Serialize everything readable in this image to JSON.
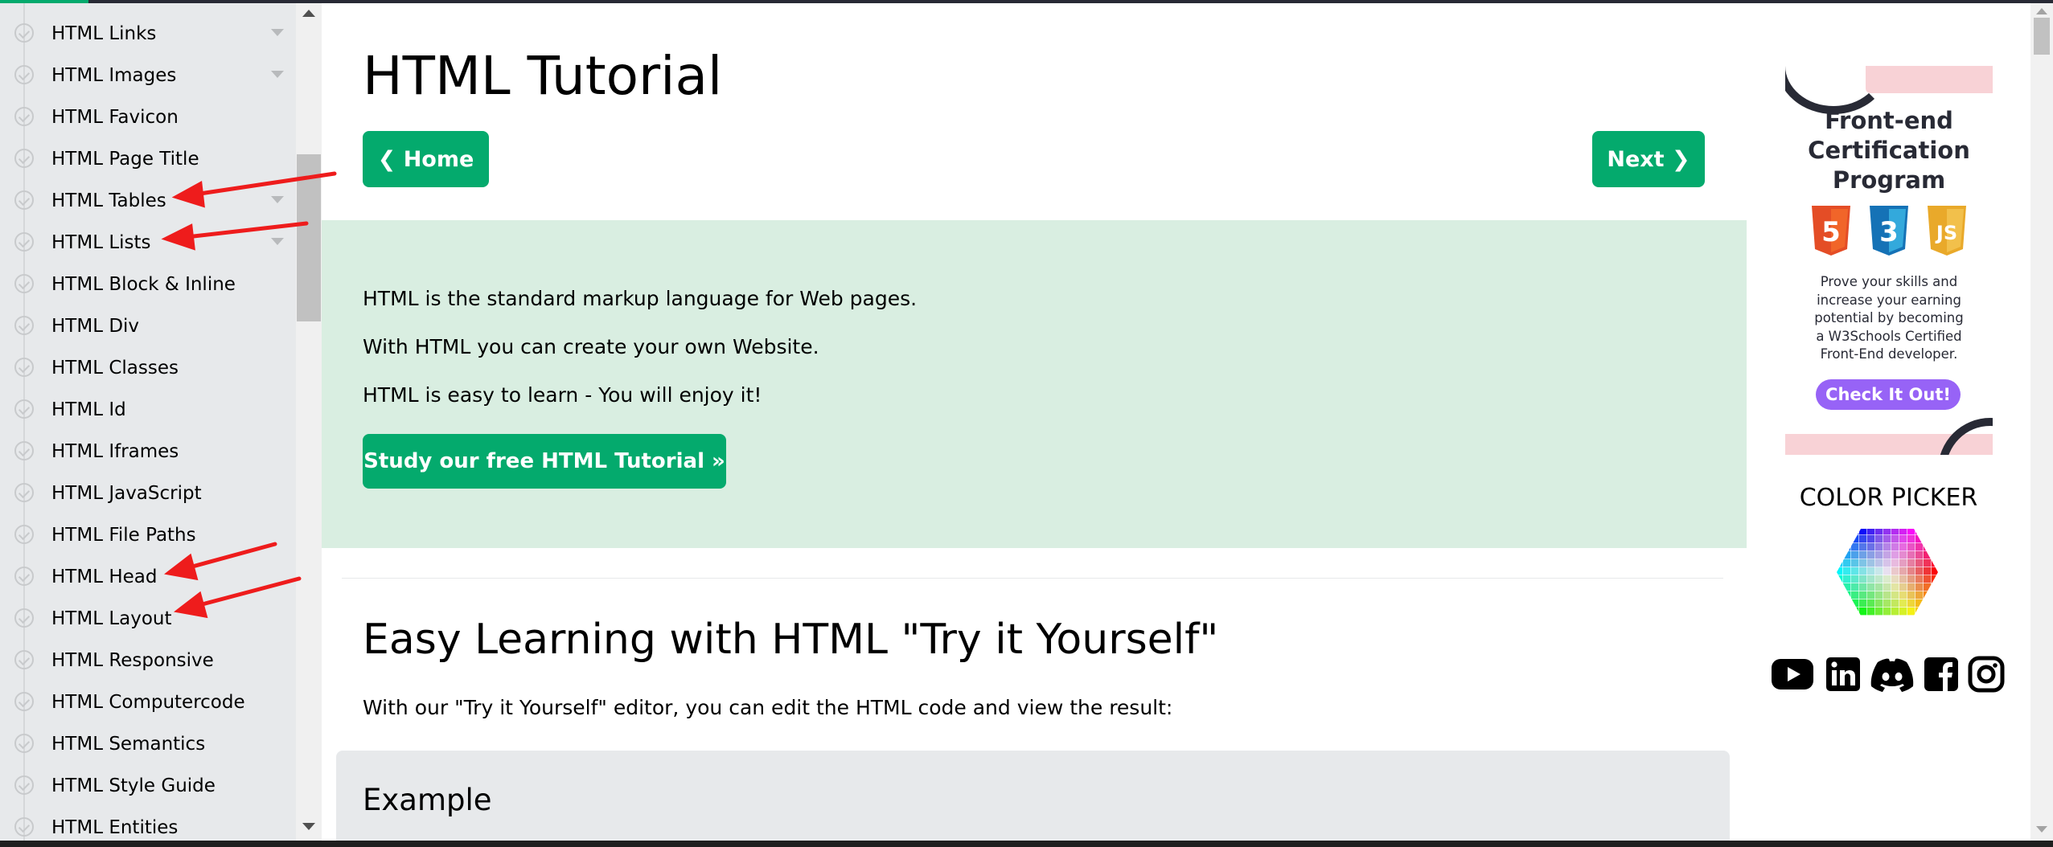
{
  "sidebar": {
    "items": [
      {
        "label": "HTML Links",
        "has_caret": true
      },
      {
        "label": "HTML Images",
        "has_caret": true
      },
      {
        "label": "HTML Favicon",
        "has_caret": false
      },
      {
        "label": "HTML Page Title",
        "has_caret": false
      },
      {
        "label": "HTML Tables",
        "has_caret": true
      },
      {
        "label": "HTML Lists",
        "has_caret": true
      },
      {
        "label": "HTML Block & Inline",
        "has_caret": false
      },
      {
        "label": "HTML Div",
        "has_caret": false
      },
      {
        "label": "HTML Classes",
        "has_caret": false
      },
      {
        "label": "HTML Id",
        "has_caret": false
      },
      {
        "label": "HTML Iframes",
        "has_caret": false
      },
      {
        "label": "HTML JavaScript",
        "has_caret": false
      },
      {
        "label": "HTML File Paths",
        "has_caret": false
      },
      {
        "label": "HTML Head",
        "has_caret": false
      },
      {
        "label": "HTML Layout",
        "has_caret": false
      },
      {
        "label": "HTML Responsive",
        "has_caret": false
      },
      {
        "label": "HTML Computercode",
        "has_caret": false
      },
      {
        "label": "HTML Semantics",
        "has_caret": false
      },
      {
        "label": "HTML Style Guide",
        "has_caret": false
      },
      {
        "label": "HTML Entities",
        "has_caret": false
      }
    ]
  },
  "main": {
    "title": "HTML Tutorial",
    "home_button": "❮ Home",
    "next_button": "Next ❯",
    "hero": {
      "line1": "HTML is the standard markup language for Web pages.",
      "line2": "With HTML you can create your own Website.",
      "line3": "HTML is easy to learn - You will enjoy it!",
      "cta": "Study our free HTML Tutorial »"
    },
    "section_title": "Easy Learning with HTML \"Try it Yourself\"",
    "section_text": "With our \"Try it Yourself\" editor, you can edit the HTML code and view the result:",
    "example_title": "Example"
  },
  "right": {
    "ad": {
      "title_line1": "Front-end",
      "title_line2": "Certification",
      "title_line3": "Program",
      "badges": [
        "5",
        "3",
        "JS"
      ],
      "text_line1": "Prove your skills and",
      "text_line2": "increase your earning",
      "text_line3": "potential by becoming",
      "text_line4": "a W3Schools Certified",
      "text_line5": "Front-End developer.",
      "button": "Check It Out!"
    },
    "color_picker_title": "COLOR PICKER",
    "socials": [
      "youtube-icon",
      "linkedin-icon",
      "discord-icon",
      "facebook-icon",
      "instagram-icon"
    ]
  },
  "colors": {
    "accent_green": "#04aa6d",
    "hero_bg": "#d9eee1",
    "sidebar_bg": "#e7e9eb",
    "ad_purple": "#9763f6",
    "arrow_red": "#ee1c1c"
  }
}
